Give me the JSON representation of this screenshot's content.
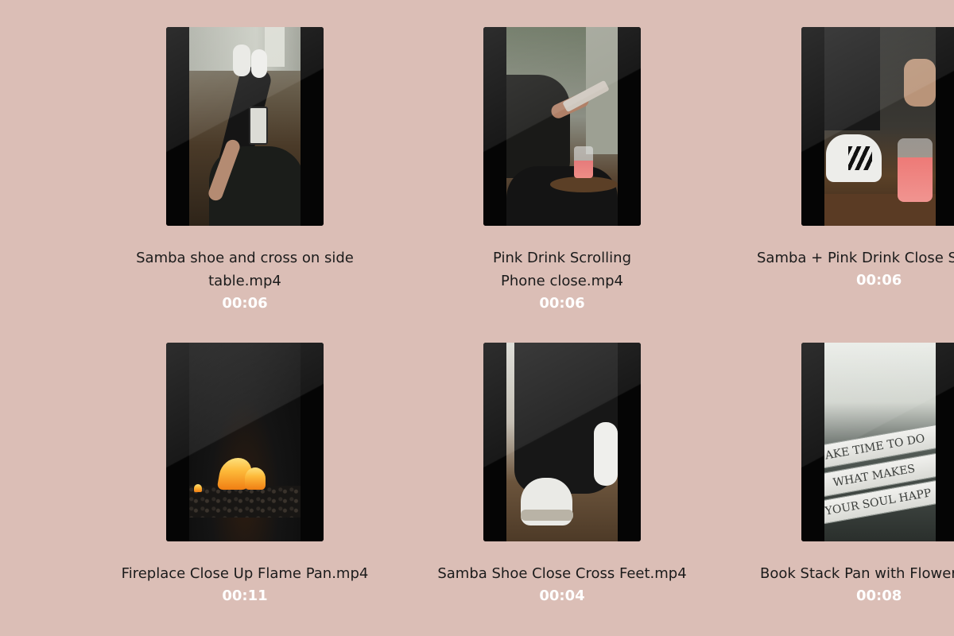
{
  "videos": [
    {
      "title": "Samba shoe and cross on side table.mp4",
      "duration": "00:06"
    },
    {
      "title": "Pink Drink Scrolling Phone close.mp4",
      "duration": "00:06"
    },
    {
      "title": "Samba + Pink Drink Close St",
      "duration": "00:06"
    },
    {
      "title": "Fireplace Close Up Flame Pan.mp4",
      "duration": "00:11"
    },
    {
      "title": "Samba Shoe Close Cross Feet.mp4",
      "duration": "00:04"
    },
    {
      "title": "Book Stack Pan with Flower",
      "duration": "00:08"
    }
  ],
  "book_spines": [
    "AKE TIME TO DO",
    "WHAT MAKES",
    "YOUR SOUL HAPP"
  ],
  "colors": {
    "background": "#dbbeb6",
    "title_text": "#1b1b1b",
    "duration_text": "#ffffff"
  }
}
